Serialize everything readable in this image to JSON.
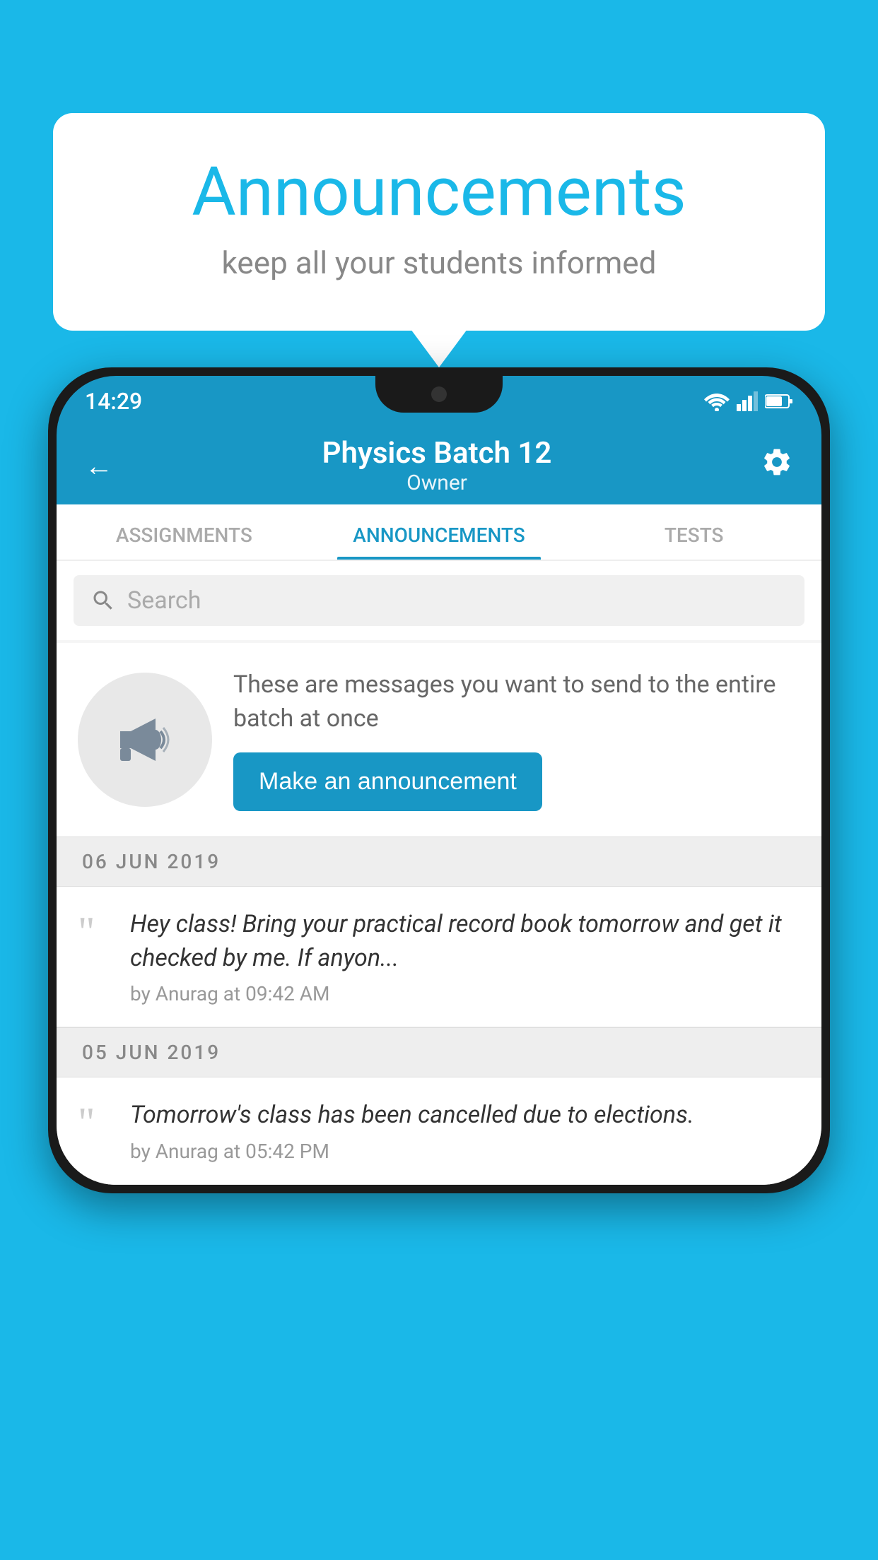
{
  "background_color": "#1ab8e8",
  "speech_bubble": {
    "title": "Announcements",
    "subtitle": "keep all your students informed"
  },
  "phone": {
    "status_bar": {
      "time": "14:29"
    },
    "app_bar": {
      "title": "Physics Batch 12",
      "subtitle": "Owner",
      "back_label": "←",
      "gear_label": "⚙"
    },
    "tabs": [
      {
        "label": "ASSIGNMENTS",
        "active": false
      },
      {
        "label": "ANNOUNCEMENTS",
        "active": true
      },
      {
        "label": "TESTS",
        "active": false
      },
      {
        "label": "...",
        "active": false
      }
    ],
    "search": {
      "placeholder": "Search"
    },
    "intro": {
      "text": "These are messages you want to send to the entire batch at once",
      "button_label": "Make an announcement"
    },
    "announcements": [
      {
        "date": "06  JUN  2019",
        "text": "Hey class! Bring your practical record book tomorrow and get it checked by me. If anyon...",
        "meta": "by Anurag at 09:42 AM"
      },
      {
        "date": "05  JUN  2019",
        "text": "Tomorrow's class has been cancelled due to elections.",
        "meta": "by Anurag at 05:42 PM"
      }
    ]
  }
}
